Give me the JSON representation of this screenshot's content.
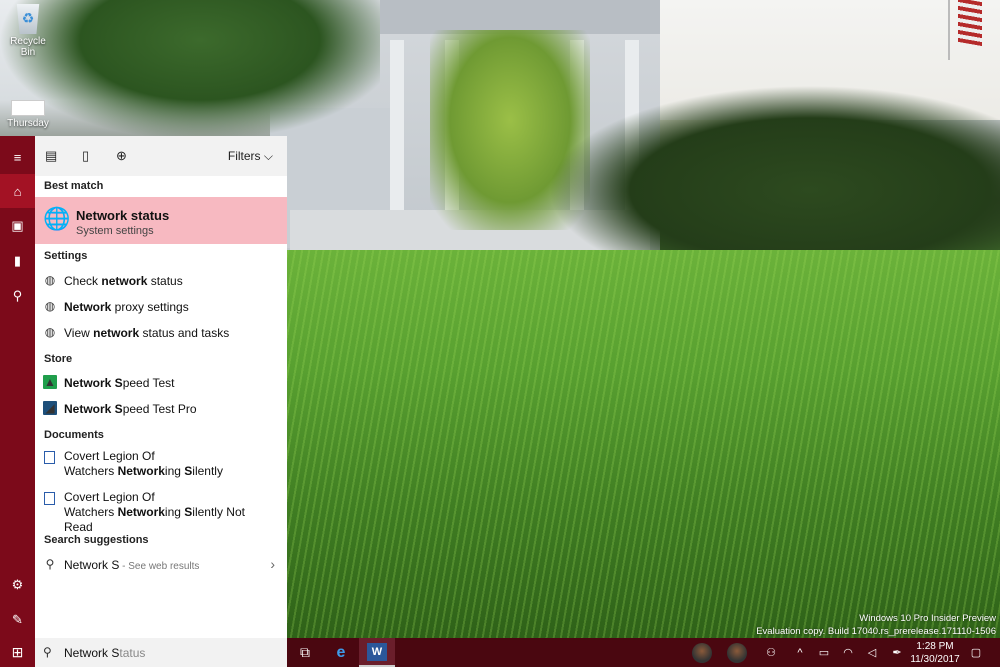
{
  "desktop": {
    "icons": [
      {
        "label": "Recycle Bin"
      },
      {
        "label": "Thursday"
      }
    ],
    "watermark": {
      "line1": "Windows 10 Pro Insider Preview",
      "line2": "Evaluation copy. Build 17040.rs_prerelease.171110-1506"
    }
  },
  "start_menu": {
    "rail": [
      {
        "icon": "hamburger-icon",
        "glyph": "≡"
      },
      {
        "icon": "home-icon",
        "glyph": "⌂"
      },
      {
        "icon": "notebook-icon",
        "glyph": "▣"
      },
      {
        "icon": "device-icon",
        "glyph": "▮"
      },
      {
        "icon": "people-icon",
        "glyph": "⚲"
      },
      {
        "icon": "settings-icon",
        "glyph": "⚙"
      },
      {
        "icon": "feedback-icon",
        "glyph": "✎"
      }
    ],
    "topbar": {
      "apps_icon": "▤",
      "documents_icon": "▯",
      "web_icon": "⊕",
      "filters_label": "Filters",
      "filters_chevron": "⌵"
    },
    "best_match": {
      "header": "Best match",
      "title": "Network status",
      "subtitle": "System settings",
      "icon": "globe-icon",
      "glyph": "🌐"
    },
    "settings": {
      "header": "Settings",
      "items": [
        {
          "pre": "Check ",
          "bold": "network",
          "post": " status",
          "glyph": "◍"
        },
        {
          "pre": "",
          "bold": "Network",
          "post": " proxy settings",
          "glyph": "◍"
        },
        {
          "pre": "View ",
          "bold": "network",
          "post": " status and tasks",
          "glyph": "◍"
        }
      ]
    },
    "store": {
      "header": "Store",
      "items": [
        {
          "bold1": "Network S",
          "mid": "peed Test",
          "glyph": "▲"
        },
        {
          "bold1": "Network S",
          "mid": "peed Test Pro",
          "glyph": "◢"
        }
      ]
    },
    "documents": {
      "header": "Documents",
      "items": [
        {
          "l1": "Covert Legion Of",
          "l2a": "Watchers ",
          "l2b": "Network",
          "l2c": "ing ",
          "l2d": "S",
          "l2e": "ilently",
          "glyph": "w"
        },
        {
          "l1": "Covert Legion Of",
          "l2a": "Watchers ",
          "l2b": "Network",
          "l2c": "ing ",
          "l2d": "S",
          "l2e": "ilently Not Read",
          "glyph": "w"
        }
      ]
    },
    "search_suggestions": {
      "header": "Search suggestions",
      "query": "Network S",
      "hint": " - See web results",
      "glyph": "⚲",
      "chevron": "›"
    }
  },
  "taskbar": {
    "start_glyph": "⊞",
    "search": {
      "glyph": "⚲",
      "typed": "Network S",
      "completion": "tatus"
    },
    "task_view_glyph": "⧉",
    "edge_glyph": "e",
    "word_glyph": "W",
    "tray": {
      "people_glyph": "⚇",
      "chevron_glyph": "^",
      "battery_glyph": "▭",
      "wifi_glyph": "◠",
      "volume_glyph": "◁",
      "pen_glyph": "✒",
      "notification_glyph": "▢"
    },
    "clock": {
      "time": "1:28 PM",
      "date": "11/30/2017"
    }
  }
}
